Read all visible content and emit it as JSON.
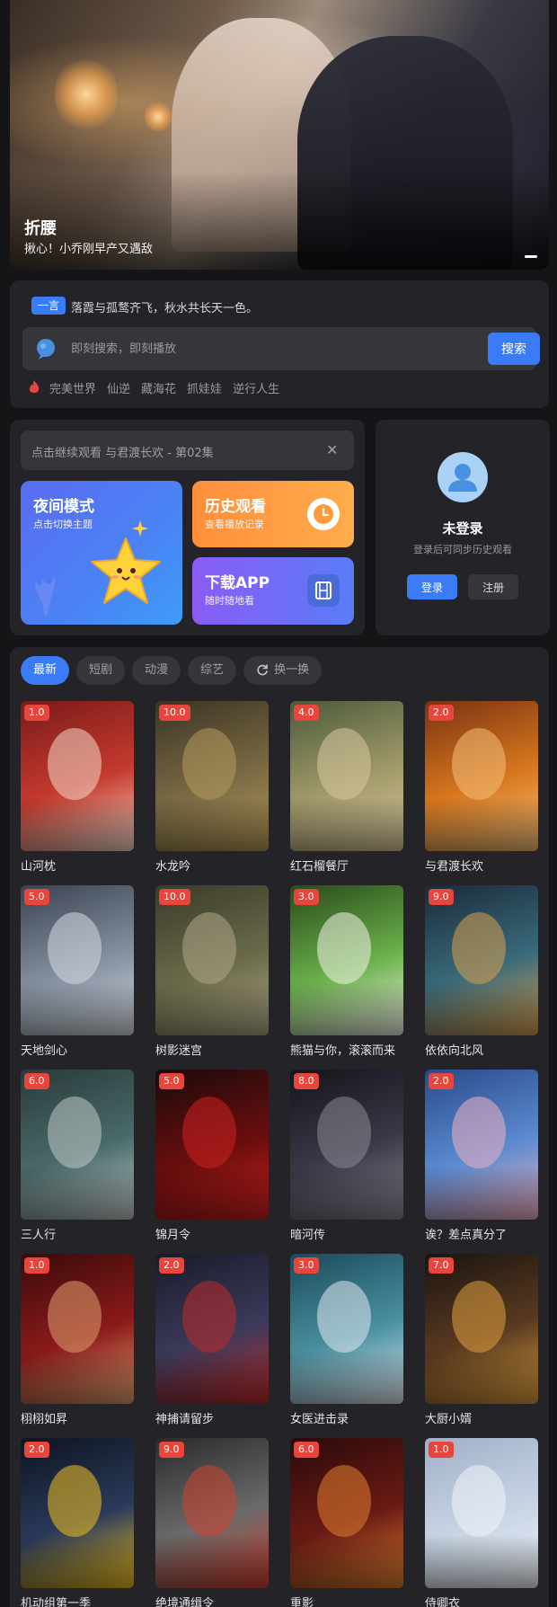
{
  "banner": {
    "title": "折腰",
    "subtitle": "揪心！小乔刚早产又遇敌"
  },
  "search": {
    "yiyan_tag": "一言",
    "yiyan_text": "落霞与孤鹜齐飞，秋水共长天一色。",
    "placeholder": "即刻搜索，即刻播放",
    "button_label": "搜索",
    "hot_keywords": [
      "完美世界",
      "仙逆",
      "藏海花",
      "抓娃娃",
      "逆行人生"
    ]
  },
  "continue_watching": {
    "text": "点击继续观看 与君渡长欢 - 第02集",
    "close_symbol": "✕"
  },
  "tiles": {
    "night": {
      "title": "夜间模式",
      "subtitle": "点击切换主题"
    },
    "history": {
      "title": "历史观看",
      "subtitle": "查看播放记录"
    },
    "app": {
      "title": "下载APP",
      "subtitle": "随时随地看"
    }
  },
  "login": {
    "title": "未登录",
    "subtitle": "登录后可同步历史观看",
    "login_label": "登录",
    "register_label": "注册"
  },
  "tabs": [
    {
      "label": "最新",
      "active": true
    },
    {
      "label": "短剧",
      "active": false
    },
    {
      "label": "动漫",
      "active": false
    },
    {
      "label": "综艺",
      "active": false
    },
    {
      "label": "换一换",
      "active": false,
      "icon": "refresh-icon"
    }
  ],
  "items": [
    {
      "title": "山河枕",
      "score": "1.0",
      "colors": [
        "#7a1a1a",
        "#c53a2e",
        "#f2d9c8"
      ]
    },
    {
      "title": "水龙吟",
      "score": "10.0",
      "colors": [
        "#3b3324",
        "#7a6a44",
        "#b59a5c"
      ]
    },
    {
      "title": "红石榴餐厅",
      "score": "4.0",
      "colors": [
        "#4a5a3a",
        "#a29a6a",
        "#d9c9a0"
      ]
    },
    {
      "title": "与君渡长欢",
      "score": "2.0",
      "colors": [
        "#7a3212",
        "#d8781f",
        "#f4c07a"
      ]
    },
    {
      "title": "天地剑心",
      "score": "5.0",
      "colors": [
        "#3a4250",
        "#8590a0",
        "#d5dbe2"
      ]
    },
    {
      "title": "树影迷宫",
      "score": "10.0",
      "colors": [
        "#3a3a2a",
        "#6a6a4a",
        "#b0a888"
      ]
    },
    {
      "title": "熊猫与你，滚滚而来",
      "score": "3.0",
      "colors": [
        "#2a4a1a",
        "#6ab04a",
        "#f2f2e8"
      ]
    },
    {
      "title": "依依向北风",
      "score": "9.0",
      "colors": [
        "#1a2a3a",
        "#3a6a7a",
        "#d8a050"
      ]
    },
    {
      "title": "三人行",
      "score": "6.0",
      "colors": [
        "#2a3a3a",
        "#4a6a6a",
        "#c0c8c8"
      ]
    },
    {
      "title": "锦月令",
      "score": "5.0",
      "colors": [
        "#1a0a0a",
        "#6a0e0e",
        "#d02020"
      ]
    },
    {
      "title": "暗河传",
      "score": "8.0",
      "colors": [
        "#14141c",
        "#3a3a48",
        "#8a8a96"
      ]
    },
    {
      "title": "诶？差点真分了",
      "score": "2.0",
      "colors": [
        "#2a4a8a",
        "#5a8ad0",
        "#f0b0c0"
      ]
    },
    {
      "title": "栩栩如昇",
      "score": "1.0",
      "colors": [
        "#3a0a0a",
        "#8a1a1a",
        "#e0a070"
      ]
    },
    {
      "title": "神捕请留步",
      "score": "2.0",
      "colors": [
        "#1a1a2a",
        "#3a3a5a",
        "#c02a2a"
      ]
    },
    {
      "title": "女医进击录",
      "score": "3.0",
      "colors": [
        "#1a4a5a",
        "#4a90a0",
        "#e0e8f0"
      ]
    },
    {
      "title": "大厨小婿",
      "score": "7.0",
      "colors": [
        "#1a1410",
        "#5a3a20",
        "#e0a040"
      ]
    },
    {
      "title": "机动组第一季",
      "score": "2.0",
      "colors": [
        "#0e1420",
        "#2a3a5a",
        "#f0c020"
      ]
    },
    {
      "title": "绝境通缉令",
      "score": "9.0",
      "colors": [
        "#2a2a2a",
        "#6a6a6a",
        "#d04030"
      ]
    },
    {
      "title": "重影",
      "score": "6.0",
      "colors": [
        "#2a0a0a",
        "#6a1a14",
        "#e08030"
      ]
    },
    {
      "title": "侍卿衣",
      "score": "1.0",
      "colors": [
        "#a0b0c8",
        "#c8d4e4",
        "#f0f4fa"
      ]
    }
  ]
}
